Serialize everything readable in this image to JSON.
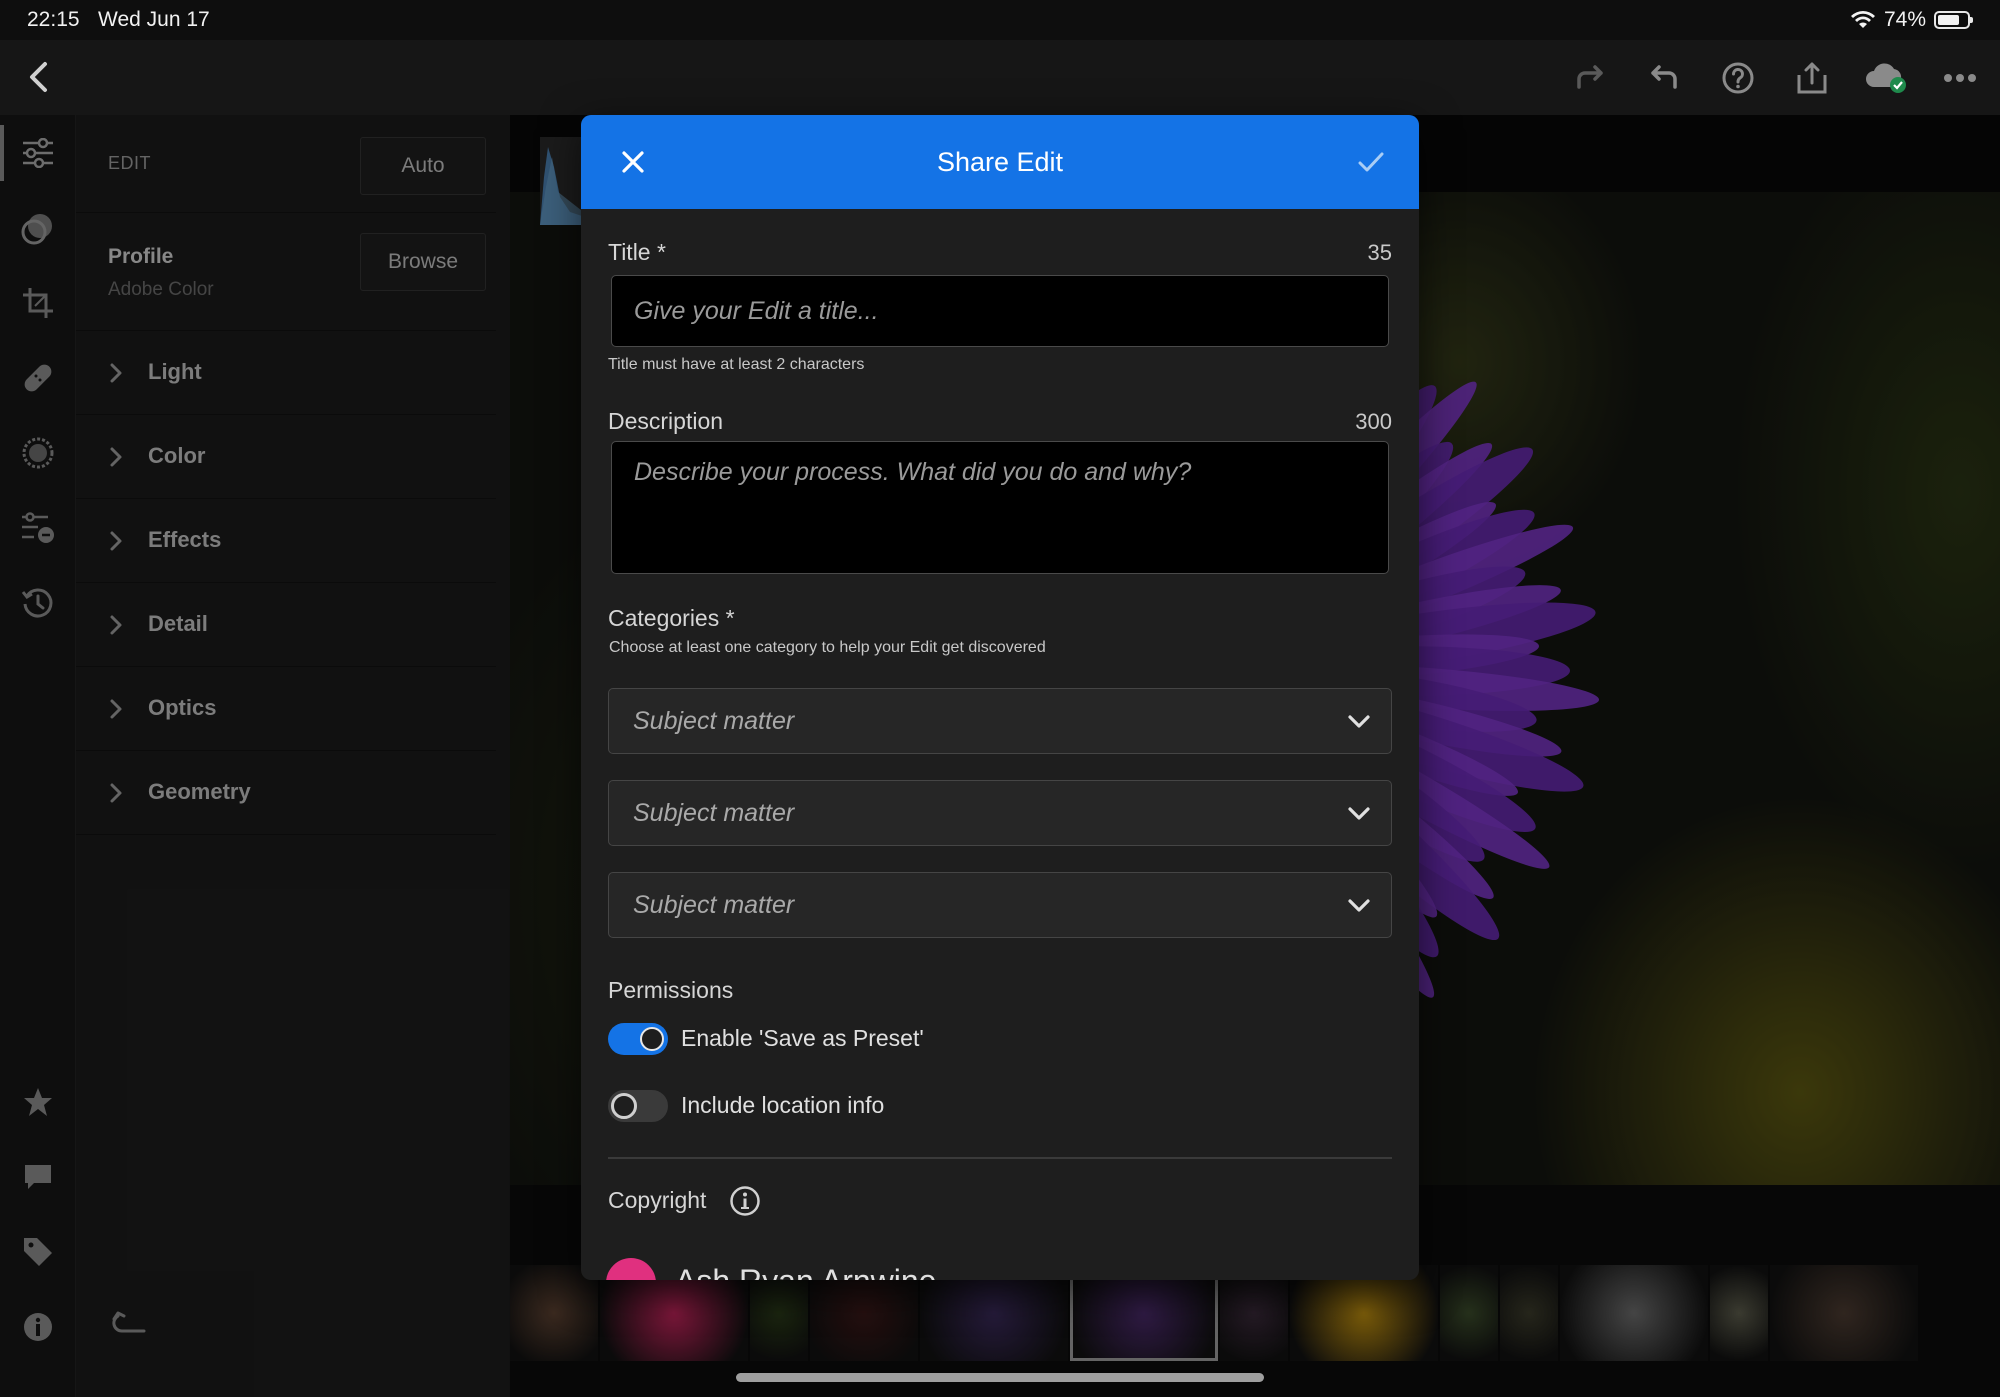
{
  "status_bar": {
    "time": "22:15",
    "date": "Wed Jun 17",
    "battery_text": "74%",
    "battery_level": 0.74
  },
  "toolbar": {
    "back_icon": "chevron-left-icon",
    "icons": [
      "redo-icon",
      "undo-icon",
      "help-icon",
      "share-icon",
      "cloud-synced-icon",
      "more-icon"
    ]
  },
  "rail": {
    "top_icons": [
      "edit-sliders-icon",
      "presets-icon",
      "crop-icon",
      "healing-icon",
      "selective-icon",
      "versions-icon",
      "history-icon"
    ],
    "bottom_icons": [
      "star-icon",
      "comment-icon",
      "tag-icon",
      "info-icon"
    ]
  },
  "edit_panel": {
    "edit_label": "EDIT",
    "auto_label": "Auto",
    "profile_label": "Profile",
    "profile_value": "Adobe Color",
    "browse_label": "Browse",
    "sections": [
      "Light",
      "Color",
      "Effects",
      "Detail",
      "Optics",
      "Geometry"
    ],
    "reset_icon": "reset-icon"
  },
  "modal": {
    "title": "Share Edit",
    "title_field": {
      "label": "Title *",
      "remaining": "35",
      "placeholder": "Give your Edit a title...",
      "hint": "Title must have at least 2 characters"
    },
    "description_field": {
      "label": "Description",
      "remaining": "300",
      "placeholder": "Describe your process. What did you do and why?"
    },
    "categories": {
      "label": "Categories *",
      "hint": "Choose at least one category to help your Edit get discovered",
      "selects": [
        "Subject matter",
        "Subject matter",
        "Subject matter"
      ]
    },
    "permissions": {
      "label": "Permissions",
      "save_as_preset": {
        "label": "Enable 'Save as Preset'",
        "on": true
      },
      "location_info": {
        "label": "Include location info",
        "on": false
      }
    },
    "copyright": {
      "label": "Copyright",
      "author": "Ash Ryan Arnwine"
    }
  },
  "colors": {
    "accent": "#1473e6",
    "panel": "#1b1b1b",
    "modal": "#1e1e1e"
  }
}
